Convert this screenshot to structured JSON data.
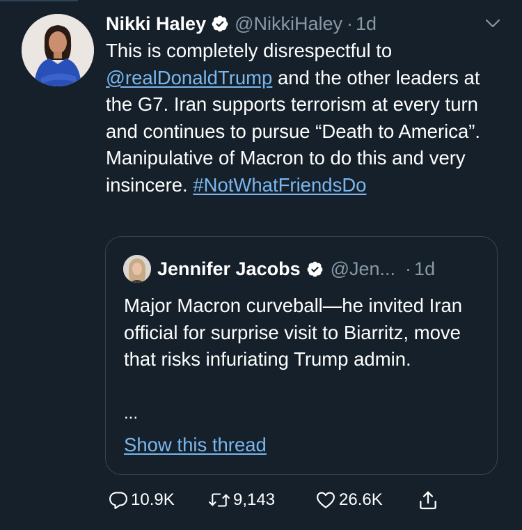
{
  "colors": {
    "background": "#15202b",
    "text": "#ffffff",
    "secondary": "#8899a6",
    "link": "#7ab7ee",
    "border": "#38444d"
  },
  "tweet": {
    "author_name": "Nikki Haley",
    "handle": "@NikkiHaley",
    "dot": "·",
    "time": "1d",
    "text_before": "This is completely disrespectful to ",
    "mention": "@realDonaldTrump",
    "text_middle": " and the other leaders at the G7. Iran supports terrorism at every turn and continues to pursue “Death to America”. Manipulative of Macron to do this and very insincere. ",
    "hashtag": "#NotWhatFriendsDo"
  },
  "quoted": {
    "author_name": "Jennifer Jacobs",
    "handle": "@Jen...",
    "dot": "·",
    "time": "1d",
    "text": "Major Macron curveball—he invited Iran official for surprise visit to Biarritz, move that risks infuriating Trump admin.",
    "ellipsis": "...",
    "show_thread": "Show this thread"
  },
  "actions": {
    "reply_count": "10.9K",
    "retweet_count": "9,143",
    "like_count": "26.6K"
  },
  "icons": [
    "verified-badge-icon",
    "chevron-down-icon",
    "reply-icon",
    "retweet-icon",
    "like-icon",
    "share-icon"
  ]
}
